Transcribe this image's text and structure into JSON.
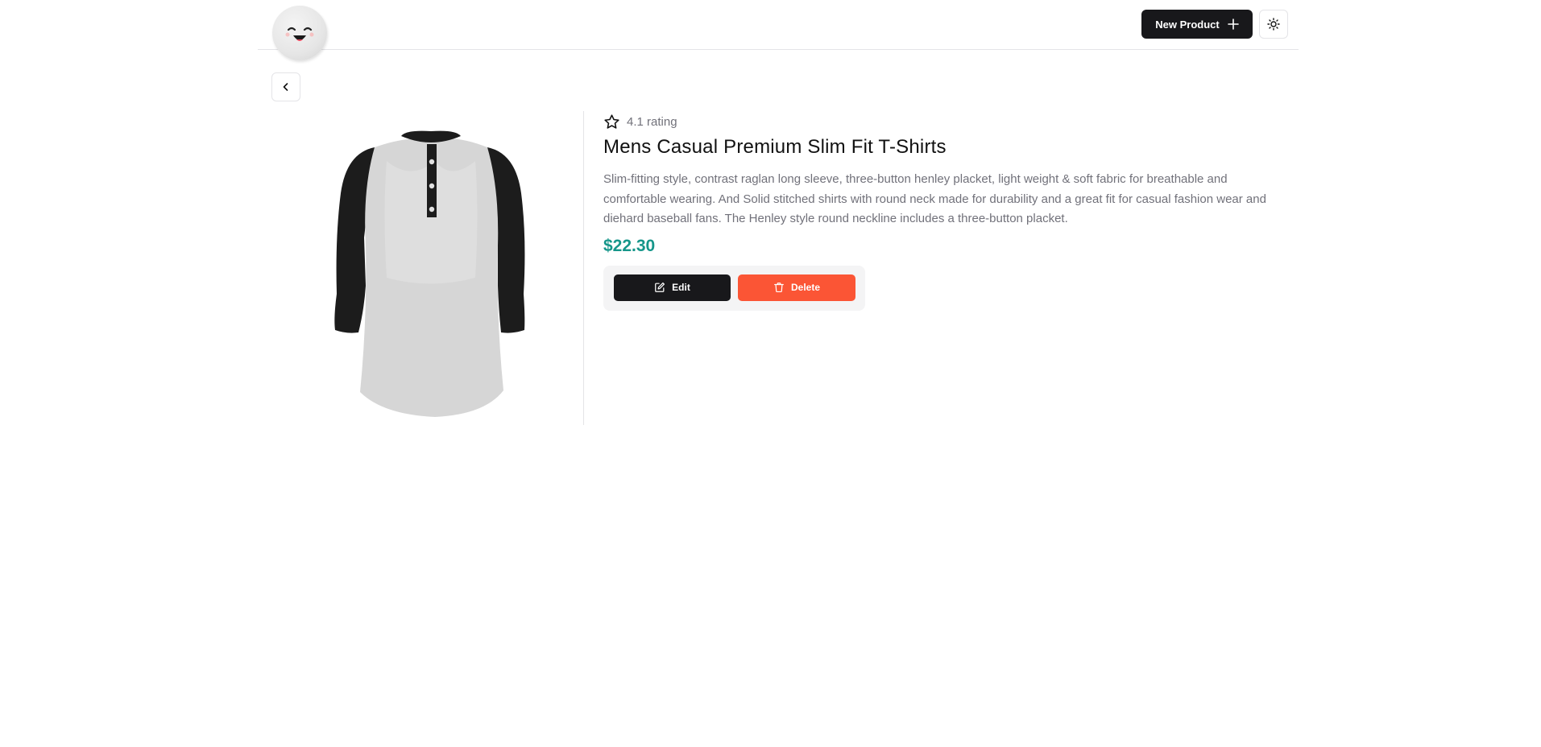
{
  "header": {
    "logo_icon": "smiley-face-icon",
    "new_product_label": "New Product",
    "new_product_icon": "plus-icon",
    "theme_icon": "sun-icon"
  },
  "navigation": {
    "back_icon": "chevron-left-icon"
  },
  "product": {
    "image_icon": "henley-shirt-image",
    "rating_icon": "star-icon",
    "rating_text": "4.1 rating",
    "title": "Mens Casual Premium Slim Fit T-Shirts",
    "description": "Slim-fitting style, contrast raglan long sleeve, three-button henley placket, light weight & soft fabric for breathable and comfortable wearing. And Solid stitched shirts with round neck made for durability and a great fit for casual fashion wear and diehard baseball fans. The Henley style round neckline includes a three-button placket.",
    "price": "$22.30"
  },
  "actions": {
    "edit_label": "Edit",
    "edit_icon": "pencil-square-icon",
    "delete_label": "Delete",
    "delete_icon": "trash-icon"
  },
  "colors": {
    "primary": "#18181b",
    "danger": "#fb5535",
    "price": "#16968a",
    "muted_text": "#71717a"
  }
}
